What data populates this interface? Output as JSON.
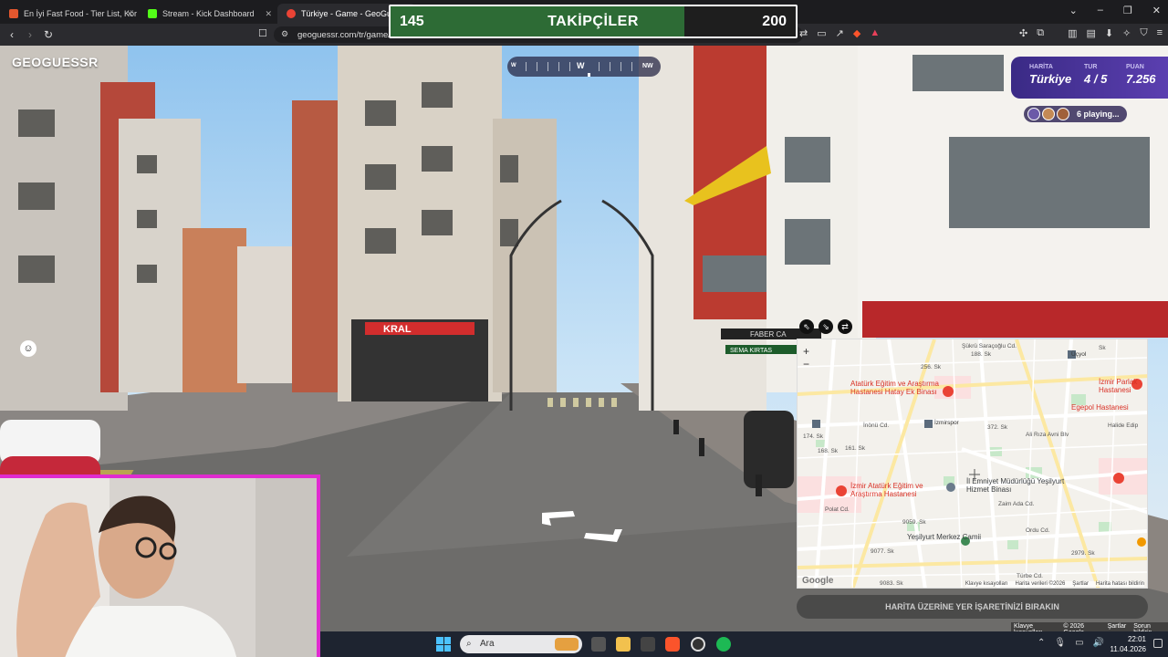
{
  "browser": {
    "tabs": [
      {
        "label": "En İyi Fast Food - Tier List, Kör Sıralam",
        "color": "#e4572e",
        "active": false
      },
      {
        "label": "Stream - Kick Dashboard",
        "color": "#53fc18",
        "active": false
      },
      {
        "label": "Türkiye - Game - GeoGuessr",
        "color": "#ea4335",
        "active": true
      }
    ],
    "url": "geoguessr.com/tr/game/",
    "new_tab": "+"
  },
  "overlay": {
    "followers_current": "145",
    "followers_label": "TAKİPÇİLER",
    "followers_goal": "200",
    "progress_fraction": 0.725,
    "fill_color": "#2d6b35"
  },
  "game": {
    "logo": "GEOGUESSR",
    "compass": {
      "labels": [
        "W",
        "NW"
      ],
      "left_mark": "W"
    },
    "map_label": "HARİTA",
    "map_value": "Türkiye",
    "round_label": "TUR",
    "round_value": "4 / 5",
    "score_label": "PUAN",
    "score_value": "7.256",
    "playing": "6 playing...",
    "guess_button": "HARİTA ÜZERİNE YER İŞARETİNİZİ BIRAKIN"
  },
  "map": {
    "zoom_in": "+",
    "zoom_out": "−",
    "google": "Google",
    "labels": [
      {
        "text": "Şükrü Saraçoğlu Cd.",
        "kind": "street"
      },
      {
        "text": "Üçyol",
        "kind": "transit"
      },
      {
        "text": "Atatürk Eğitim ve Araştırma Hastanesi Hatay Ek Binası",
        "kind": "hospital"
      },
      {
        "text": "İzmir Parlak Hastanesi",
        "kind": "hospital"
      },
      {
        "text": "Egepol Hastanesi",
        "kind": "hospital"
      },
      {
        "text": "İnönü Cd.",
        "kind": "street"
      },
      {
        "text": "İzmirspor",
        "kind": "transit"
      },
      {
        "text": "Ali Rıza Avni Blv",
        "kind": "street"
      },
      {
        "text": "İzmir Atatürk Eğitim ve Araştırma Hastanesi",
        "kind": "hospital"
      },
      {
        "text": "İl Emniyet Müdürlüğü Yeşilyurt Hizmet Binası",
        "kind": "poi"
      },
      {
        "text": "Polat Cd.",
        "kind": "street"
      },
      {
        "text": "Yeşilyurt Merkez Camii",
        "kind": "poi"
      },
      {
        "text": "Halide Edip",
        "kind": "street"
      },
      {
        "text": "Zaim Ada Cd.",
        "kind": "street"
      },
      {
        "text": "Ordu Cd.",
        "kind": "street"
      },
      {
        "text": "Türbe Cd.",
        "kind": "street"
      },
      {
        "text": "9059. Sk",
        "kind": "street"
      },
      {
        "text": "9077. Sk",
        "kind": "street"
      },
      {
        "text": "9083. Sk",
        "kind": "street"
      },
      {
        "text": "2979. Sk",
        "kind": "street"
      },
      {
        "text": "188. Sk",
        "kind": "street"
      },
      {
        "text": "256. Sk",
        "kind": "street"
      },
      {
        "text": "174. Sk",
        "kind": "street"
      },
      {
        "text": "168. Sk",
        "kind": "street"
      },
      {
        "text": "161. Sk",
        "kind": "street"
      },
      {
        "text": "372. Sk",
        "kind": "street"
      },
      {
        "text": "Sk",
        "kind": "street"
      }
    ],
    "footer": [
      "Klavye kısayolları",
      "Harita verileri ©2026",
      "Şartlar",
      "Harita hatası bildirin"
    ]
  },
  "page_footer": [
    "Klavye kısayolları",
    "© 2026 Google",
    "Şartlar",
    "Sorun bildirin"
  ],
  "street_signs": [
    "KRAL",
    "FABER CA",
    "SEMA KIRTAS"
  ],
  "taskbar": {
    "search_placeholder": "Ara",
    "time": "22:01",
    "date": "11.04.2026"
  }
}
